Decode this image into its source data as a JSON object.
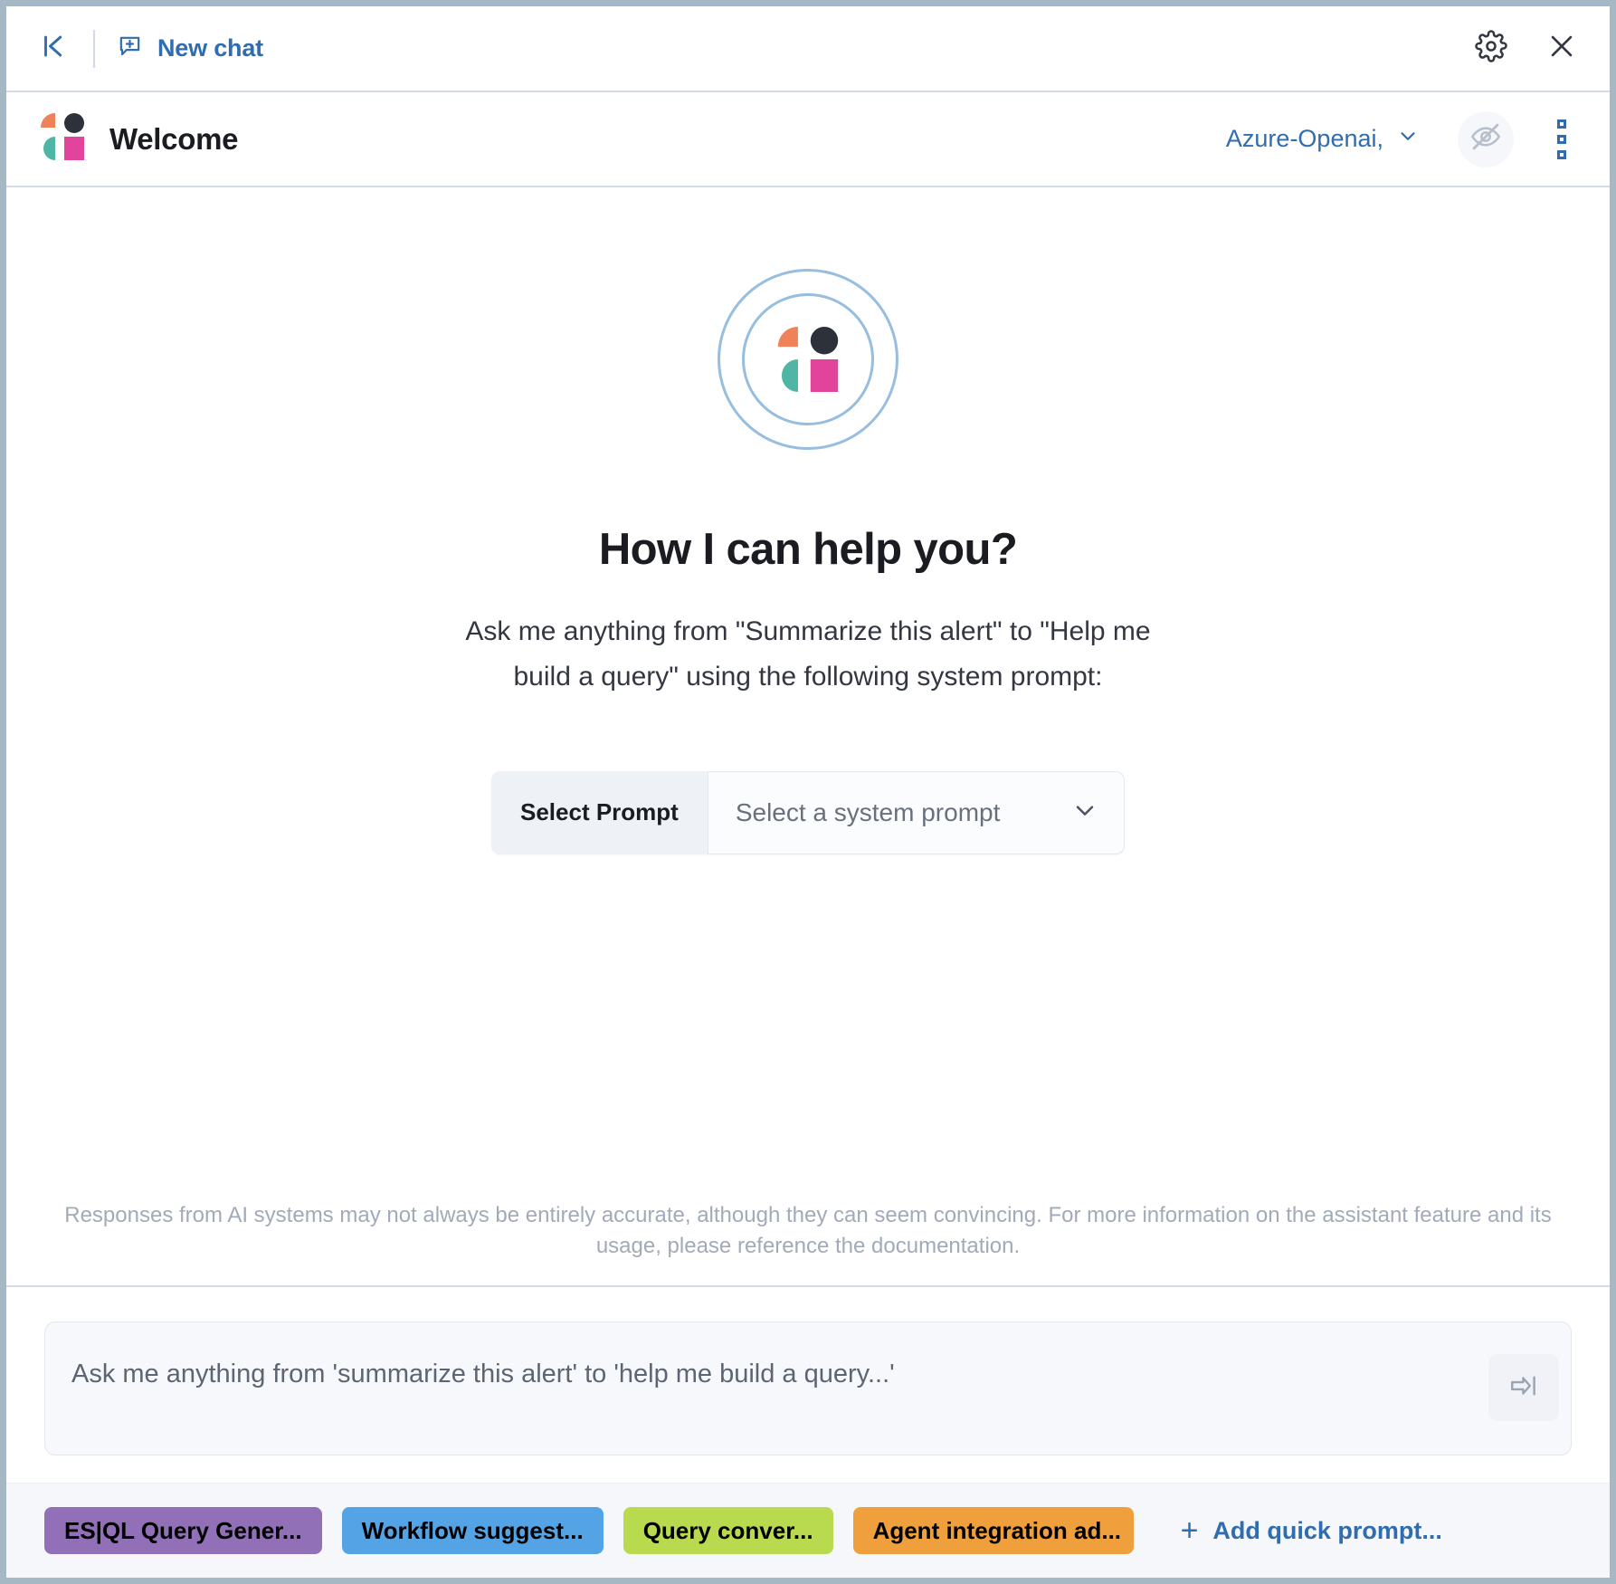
{
  "topbar": {
    "collapse_icon": "collapse-left-icon",
    "new_chat_label": "New chat",
    "new_chat_icon": "new-comment-icon",
    "settings_icon": "gear-icon",
    "close_icon": "close-icon"
  },
  "header": {
    "title": "Welcome",
    "logo_icon": "elastic-ai-assistant-logo",
    "connector_label": "Azure-Openai,",
    "connector_chevron_icon": "chevron-down-icon",
    "visibility_icon": "eye-off-icon",
    "menu_icon": "vertical-dots-icon"
  },
  "hero": {
    "logo_icon": "elastic-ai-assistant-logo-rings",
    "title": "How I can help you?",
    "subtitle": "Ask me anything from \"Summarize this alert\" to \"Help me build a query\" using the following system prompt:",
    "prompt_selector": {
      "prepend_label": "Select Prompt",
      "placeholder": "Select a system prompt",
      "chevron_icon": "chevron-down-icon"
    }
  },
  "disclaimer": "Responses from AI systems may not always be entirely accurate, although they can seem convincing. For more information on the assistant feature and its usage, please reference the documentation.",
  "input": {
    "placeholder": "Ask me anything from 'summarize this alert' to 'help me build a query...'",
    "value": "",
    "send_icon": "submit-arrow-icon"
  },
  "footer": {
    "quick_prompts": [
      {
        "label": "ES|QL Query Gener...",
        "color": "#9170b8"
      },
      {
        "label": "Workflow suggest...",
        "color": "#54a4e5"
      },
      {
        "label": "Query conver...",
        "color": "#b9d94f"
      },
      {
        "label": "Agent integration ad...",
        "color": "#efa03c"
      }
    ],
    "add_label": "Add quick prompt...",
    "add_icon": "plus-icon"
  },
  "colors": {
    "link": "#2f6cb0",
    "border": "#d3dae6",
    "window_border": "#a6b8c4",
    "text": "#1a1c21",
    "muted": "#a2aab9",
    "logo_orange": "#f0825a",
    "logo_dark": "#2c313a",
    "logo_teal": "#4fb6a5",
    "logo_pink": "#e1449a"
  }
}
